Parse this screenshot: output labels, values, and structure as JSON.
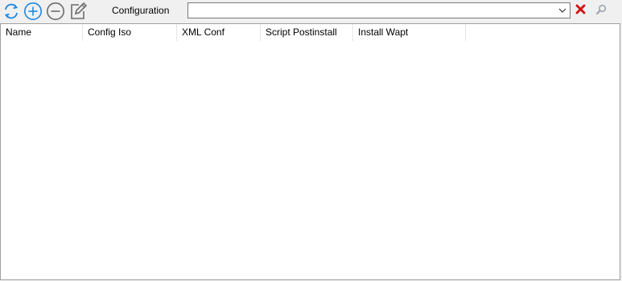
{
  "toolbar": {
    "config_label": "Configuration",
    "config_value": "",
    "icons": {
      "refresh": "refresh-icon",
      "add": "plus-circle-icon",
      "remove": "minus-circle-icon",
      "edit": "edit-icon",
      "dropdown": "chevron-down-icon",
      "clear": "red-x-icon",
      "search": "magnifier-icon"
    }
  },
  "grid": {
    "columns": [
      {
        "label": "Name"
      },
      {
        "label": "Config Iso"
      },
      {
        "label": "XML Conf"
      },
      {
        "label": "Script Postinstall"
      },
      {
        "label": "Install Wapt"
      }
    ],
    "rows": []
  },
  "colors": {
    "accent_blue": "#1e88e5",
    "grey_icon": "#6b6b6b",
    "clear_red": "#d01010"
  }
}
